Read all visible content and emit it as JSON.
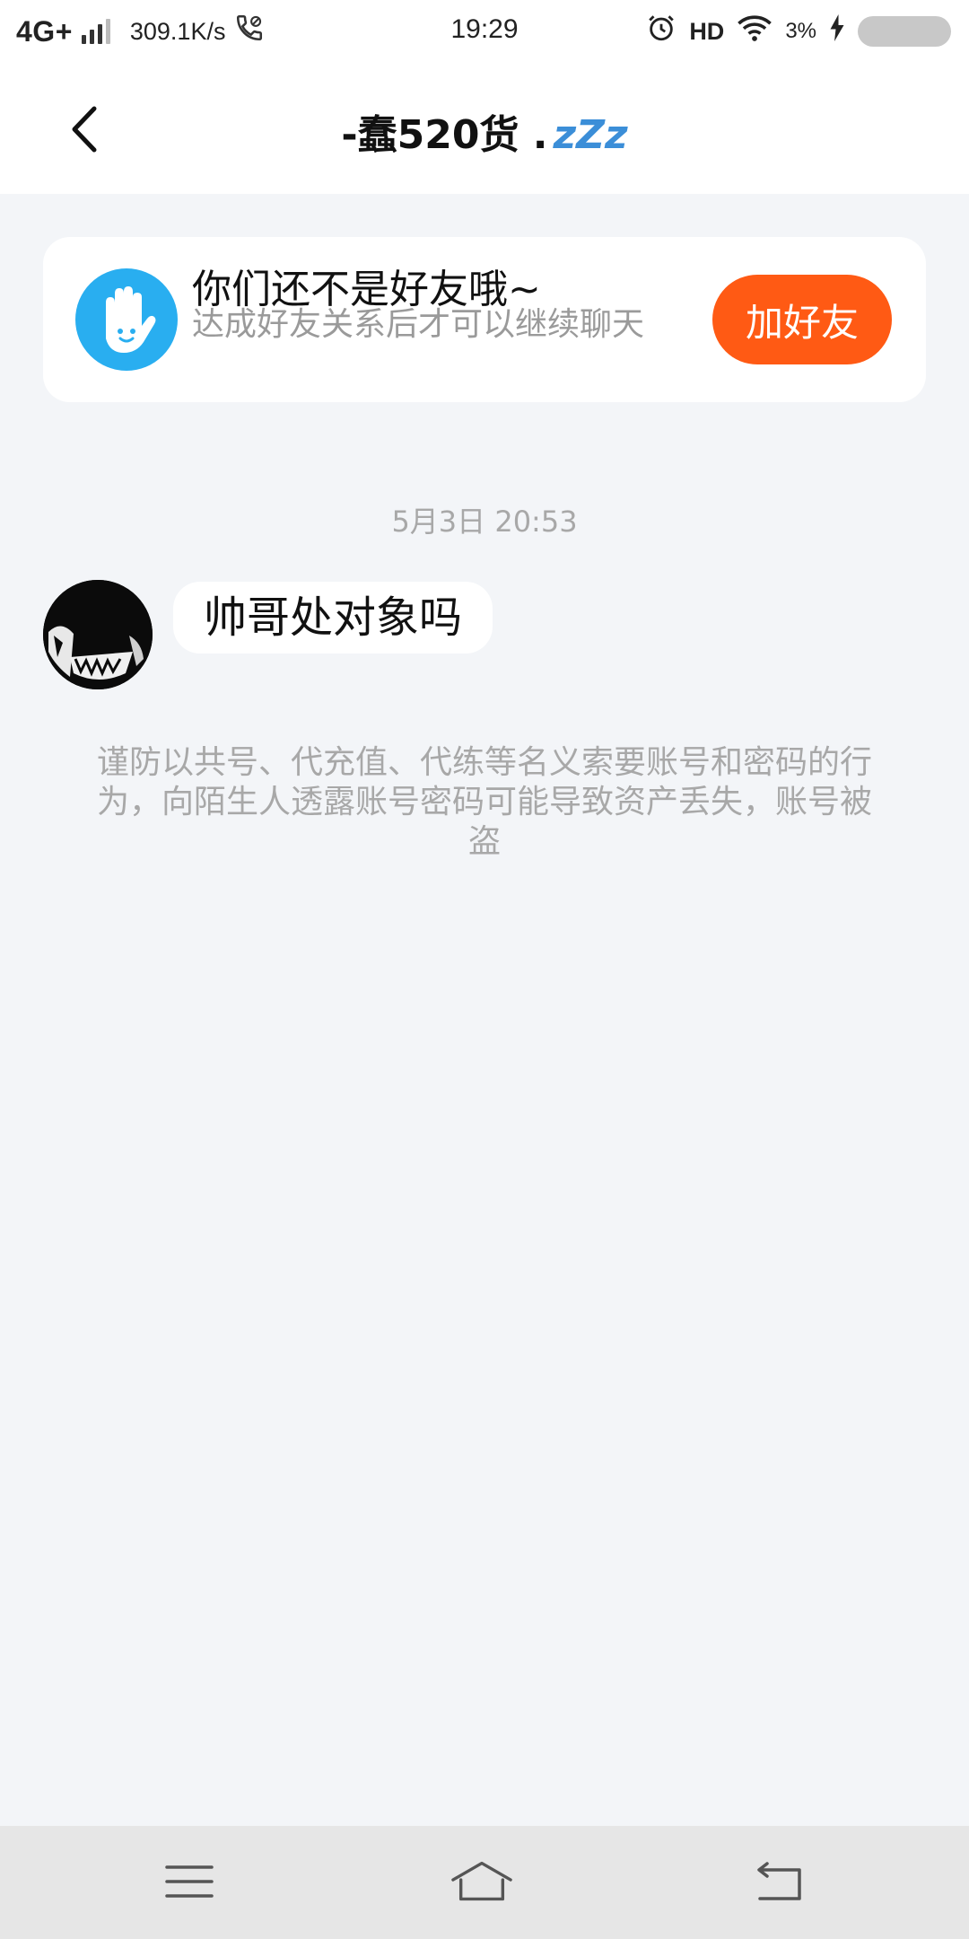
{
  "status_bar": {
    "network": "4G+",
    "speed": "309.1K/s",
    "time": "19:29",
    "hd": "HD",
    "battery": "3%"
  },
  "header": {
    "title": "-蠢520货 .",
    "status_glyph": "zZz"
  },
  "friend_prompt": {
    "title": "你们还不是好友哦~",
    "subtitle": "达成好友关系后才可以继续聊天",
    "button_label": "加好友",
    "button_color": "#ff5a14",
    "icon": "waving-hand-icon"
  },
  "chat": {
    "timestamp": "5月3日 20:53",
    "messages": [
      {
        "sender": "other",
        "text": "帅哥处对象吗"
      }
    ],
    "warning": "谨防以共号、代充值、代练等名义索要账号和密码的行为，向陌生人透露账号密码可能导致资产丢失，账号被盗"
  },
  "navigation": {
    "icons": [
      "menu-icon",
      "home-icon",
      "back-icon"
    ]
  }
}
